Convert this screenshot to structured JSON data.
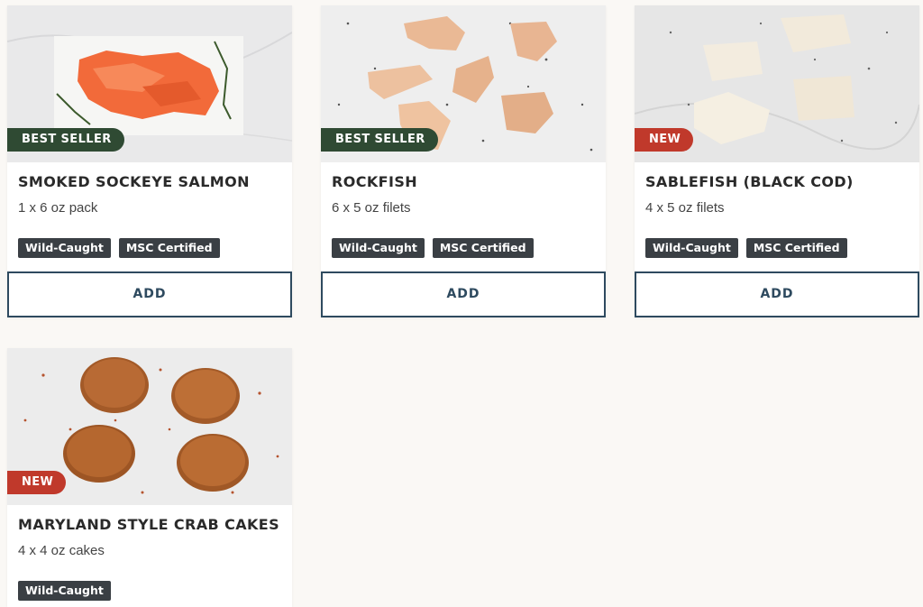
{
  "products": [
    {
      "title": "SMOKED SOCKEYE SALMON",
      "size": "1 x 6 oz pack",
      "badge": "BEST SELLER",
      "tags": [
        "Wild-Caught",
        "MSC Certified"
      ],
      "add_label": "ADD"
    },
    {
      "title": "ROCKFISH",
      "size": "6 x 5 oz filets",
      "badge": "BEST SELLER",
      "tags": [
        "Wild-Caught",
        "MSC Certified"
      ],
      "add_label": "ADD"
    },
    {
      "title": "SABLEFISH (BLACK COD)",
      "size": "4 x 5 oz filets",
      "badge": "NEW",
      "tags": [
        "Wild-Caught",
        "MSC Certified"
      ],
      "add_label": "ADD"
    },
    {
      "title": "MARYLAND STYLE CRAB CAKES",
      "size": "4 x 4 oz cakes",
      "badge": "NEW",
      "tags": [
        "Wild-Caught"
      ]
    }
  ],
  "colors": {
    "best_seller_badge": "#2f4a33",
    "new_badge": "#c0392b",
    "tag_bg": "#3a3f44",
    "add_button_border": "#2e4a5f"
  }
}
